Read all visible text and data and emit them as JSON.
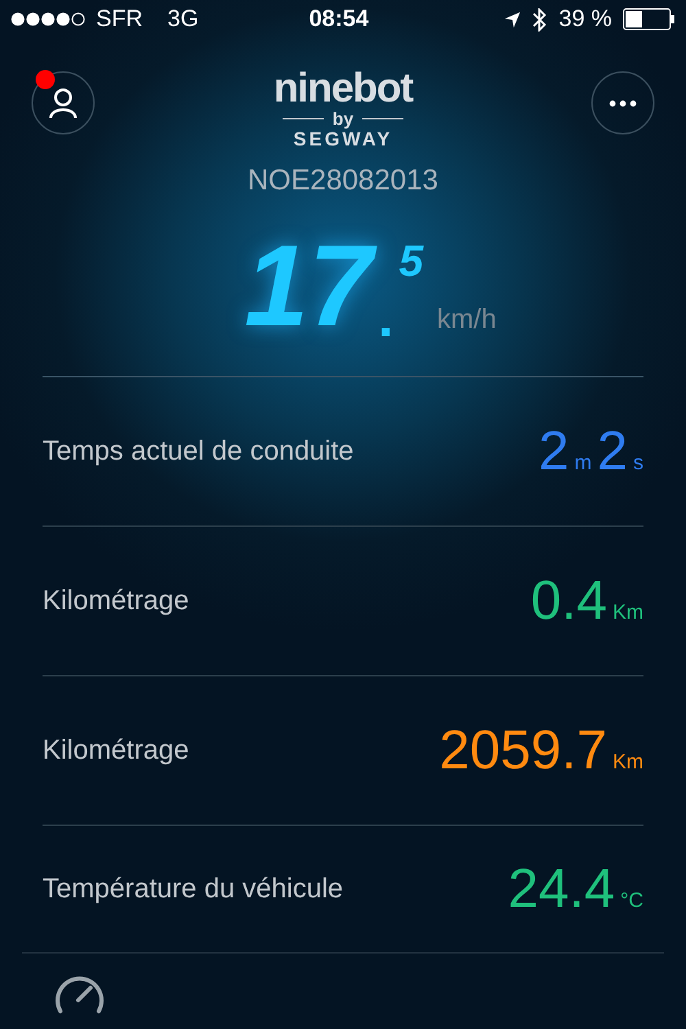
{
  "status_bar": {
    "carrier": "SFR",
    "network": "3G",
    "time": "08:54",
    "battery": "39 %"
  },
  "header": {
    "notification": true,
    "logo": {
      "brand": "ninebot",
      "by": "by",
      "maker": "SEGWAY"
    }
  },
  "device_id": "NOE28082013",
  "speed": {
    "whole": "17",
    "point": ".",
    "decimal": "5",
    "unit": "km/h"
  },
  "stats": [
    {
      "label": "Temps actuel de conduite",
      "color": "#2f7cf0",
      "parts": [
        {
          "number": "2",
          "unit": "m"
        },
        {
          "number": "2",
          "unit": "s"
        }
      ]
    },
    {
      "label": "Kilométrage",
      "color": "#1fc07c",
      "parts": [
        {
          "number": "0.4",
          "unit": "Km"
        }
      ]
    },
    {
      "label": "Kilométrage",
      "color": "#ff8a10",
      "parts": [
        {
          "number": "2059.7",
          "unit": "Km"
        }
      ]
    },
    {
      "label": "Température du véhicule",
      "color": "#1fc07c",
      "parts": [
        {
          "number": "24.4",
          "unit": "°C"
        }
      ]
    }
  ]
}
